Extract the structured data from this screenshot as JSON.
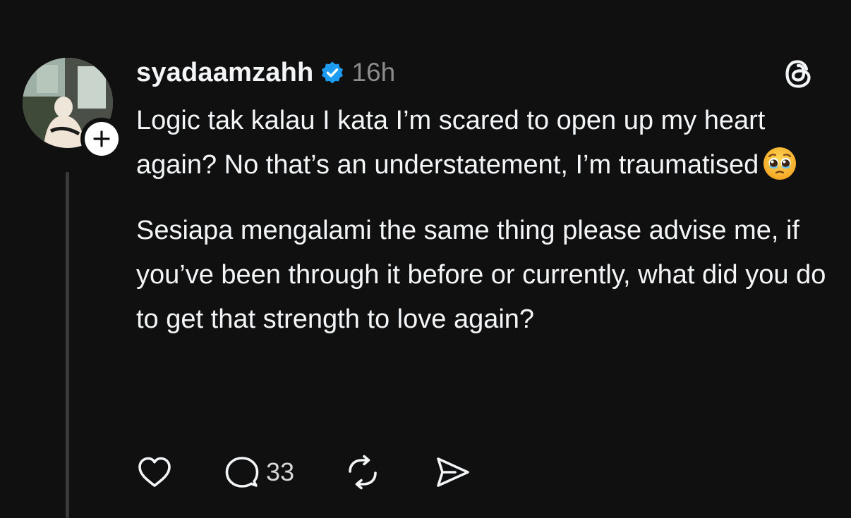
{
  "post": {
    "username": "syadaamzahh",
    "verified": true,
    "timestamp": "16h",
    "paragraphs": [
      "Logic tak kalau I kata I’m scared to open up my heart again? No that’s an understatement, I’m traumatised",
      "Sesiapa mengalami the same thing please advise me, if you’ve been through it before or currently, what did you do to get that strength to love again?"
    ],
    "emoji": "pleading-face"
  },
  "actions": {
    "like_icon": "heart-icon",
    "reply_icon": "comment-icon",
    "reply_count": "33",
    "repost_icon": "repost-icon",
    "share_icon": "send-icon"
  },
  "colors": {
    "background": "#101010",
    "text": "#f3f5f7",
    "secondary_text": "#8c8c8c",
    "verified_badge": "#1d9bf0",
    "thread_line": "#3a3a3a"
  }
}
